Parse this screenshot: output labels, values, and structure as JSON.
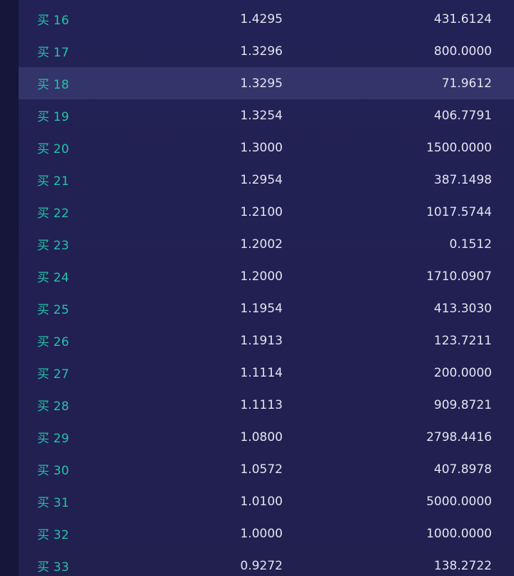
{
  "orderbook": {
    "highlighted_label": "买 18",
    "rows": [
      {
        "label": "买 16",
        "price": "1.4295",
        "amount": "431.6124"
      },
      {
        "label": "买 17",
        "price": "1.3296",
        "amount": "800.0000"
      },
      {
        "label": "买 18",
        "price": "1.3295",
        "amount": "71.9612"
      },
      {
        "label": "买 19",
        "price": "1.3254",
        "amount": "406.7791"
      },
      {
        "label": "买 20",
        "price": "1.3000",
        "amount": "1500.0000"
      },
      {
        "label": "买 21",
        "price": "1.2954",
        "amount": "387.1498"
      },
      {
        "label": "买 22",
        "price": "1.2100",
        "amount": "1017.5744"
      },
      {
        "label": "买 23",
        "price": "1.2002",
        "amount": "0.1512"
      },
      {
        "label": "买 24",
        "price": "1.2000",
        "amount": "1710.0907"
      },
      {
        "label": "买 25",
        "price": "1.1954",
        "amount": "413.3030"
      },
      {
        "label": "买 26",
        "price": "1.1913",
        "amount": "123.7211"
      },
      {
        "label": "买 27",
        "price": "1.1114",
        "amount": "200.0000"
      },
      {
        "label": "买 28",
        "price": "1.1113",
        "amount": "909.8721"
      },
      {
        "label": "买 29",
        "price": "1.0800",
        "amount": "2798.4416"
      },
      {
        "label": "买 30",
        "price": "1.0572",
        "amount": "407.8978"
      },
      {
        "label": "买 31",
        "price": "1.0100",
        "amount": "5000.0000"
      },
      {
        "label": "买 32",
        "price": "1.0000",
        "amount": "1000.0000"
      },
      {
        "label": "买 33",
        "price": "0.9272",
        "amount": "138.2722"
      }
    ]
  },
  "colors": {
    "buy_label": "#25c2a6",
    "text": "#e4e4f0",
    "background": "#222052",
    "highlight_row": "#33346a"
  }
}
